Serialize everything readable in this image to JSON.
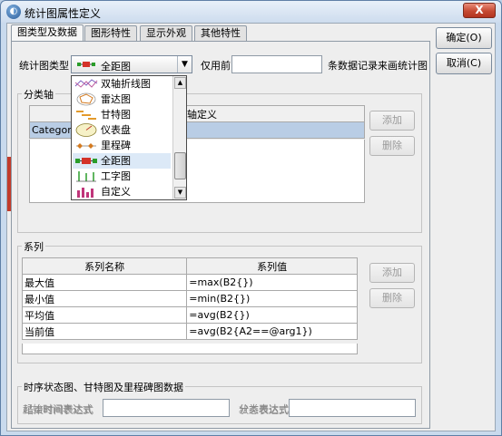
{
  "window": {
    "title": "统计图属性定义",
    "close_label": "X"
  },
  "tabs": [
    {
      "label": "图类型及数据",
      "active": true
    },
    {
      "label": "图形特性",
      "active": false
    },
    {
      "label": "显示外观",
      "active": false
    },
    {
      "label": "其他特性",
      "active": false
    }
  ],
  "buttons": {
    "ok": "确定(O)",
    "cancel": "取消(C)"
  },
  "chart_type": {
    "label": "统计图类型",
    "selected": "全距图",
    "only_before_label": "仅用前",
    "only_before_value": "",
    "suffix_label": "条数据记录来画统计图"
  },
  "dropdown_items": [
    {
      "label": "双轴折线图",
      "icon": "dual-axis-line-chart-icon",
      "selected": false
    },
    {
      "label": "雷达图",
      "icon": "radar-chart-icon",
      "selected": false
    },
    {
      "label": "甘特图",
      "icon": "gantt-chart-icon",
      "selected": false
    },
    {
      "label": "仪表盘",
      "icon": "gauge-chart-icon",
      "selected": false
    },
    {
      "label": "里程碑",
      "icon": "milestone-chart-icon",
      "selected": false
    },
    {
      "label": "全距图",
      "icon": "range-chart-icon",
      "selected": true
    },
    {
      "label": "工字图",
      "icon": "i-bar-chart-icon",
      "selected": false
    },
    {
      "label": "自定义",
      "icon": "custom-chart-icon",
      "selected": false
    }
  ],
  "category_axis": {
    "group_title": "分类轴",
    "column_header": "类轴定义",
    "rows": [
      "Category"
    ],
    "add_label": "添加",
    "delete_label": "删除"
  },
  "series": {
    "group_title": "系列",
    "headers": [
      "系列名称",
      "系列值"
    ],
    "rows": [
      {
        "name": "最大值",
        "value": "=max(B2{})"
      },
      {
        "name": "最小值",
        "value": "=min(B2{})"
      },
      {
        "name": "平均值",
        "value": "=avg(B2{})"
      },
      {
        "name": "当前值",
        "value": "=avg(B2{A2==@arg1})"
      }
    ],
    "add_label": "添加",
    "delete_label": "删除"
  },
  "timing": {
    "group_title": "时序状态图、甘特图及里程碑图数据",
    "start_label": "起始时间表达式",
    "end_label": "结束时间表达式",
    "category_label": "分类表达式",
    "status_label": "状态表达式"
  },
  "colors": {
    "accent": "#c9daed",
    "close": "#c64a33",
    "selection": "#dce9f7"
  }
}
